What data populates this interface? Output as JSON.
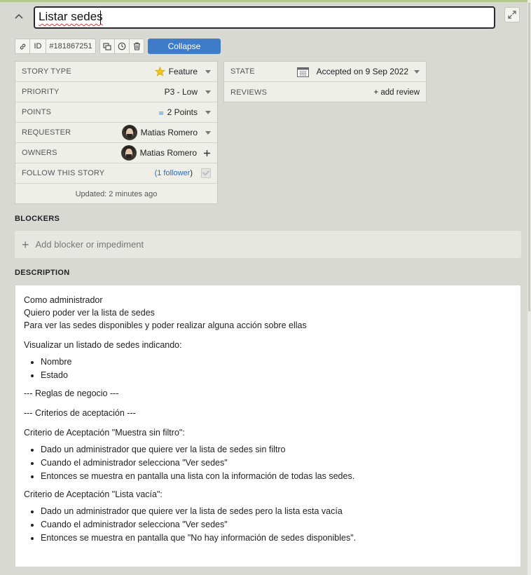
{
  "story": {
    "title": "Listar sedes",
    "id_label": "ID",
    "id_value": "#181867251",
    "collapse_label": "Collapse"
  },
  "details": [
    {
      "label": "STORY TYPE",
      "value": "Feature",
      "icon": "star-icon"
    },
    {
      "label": "PRIORITY",
      "value": "P3 - Low"
    },
    {
      "label": "POINTS",
      "value": "2 Points",
      "icon": "points-icon"
    },
    {
      "label": "REQUESTER",
      "value": "Matias Romero"
    },
    {
      "label": "OWNERS",
      "value": "Matias Romero"
    },
    {
      "label": "FOLLOW THIS STORY",
      "prefix": "(",
      "link": "1 follower",
      "suffix": ")"
    }
  ],
  "updated": "Updated: 2 minutes ago",
  "state": {
    "label": "STATE",
    "value": "Accepted on 9 Sep 2022"
  },
  "reviews": {
    "label": "REVIEWS",
    "action": "+ add review"
  },
  "blockers": {
    "heading": "BLOCKERS",
    "placeholder": "Add blocker or impediment"
  },
  "description": {
    "heading": "DESCRIPTION",
    "intro": [
      "Como administrador",
      "Quiero poder ver la lista de sedes",
      "Para ver las sedes disponibles y poder realizar alguna acción sobre ellas"
    ],
    "list_intro": "Visualizar un listado de sedes indicando:",
    "list_items": [
      "Nombre",
      "Estado"
    ],
    "rules_heading": "--- Reglas de negocio ---",
    "criteria_heading": "--- Criterios de aceptación ---",
    "criterion1_title": "Criterio de Aceptación \"Muestra sin filtro\":",
    "criterion1_items": [
      "Dado un administrador que quiere ver la lista de sedes sin filtro",
      "Cuando el administrador selecciona \"Ver sedes\"",
      "Entonces se muestra en pantalla una lista con la información de todas las sedes."
    ],
    "criterion2_title": "Criterio de Aceptación \"Lista vacía\":",
    "criterion2_items": [
      "Dado un administrador que quiere ver la lista de sedes pero la lista esta vacía",
      "Cuando el administrador selecciona \"Ver sedes\"",
      "Entonces se muestra en pantalla que \"No hay información de sedes disponibles\"."
    ]
  },
  "colors": {
    "accent": "#3e7bc9",
    "link": "#3569a8",
    "background": "#d8d9d3"
  }
}
